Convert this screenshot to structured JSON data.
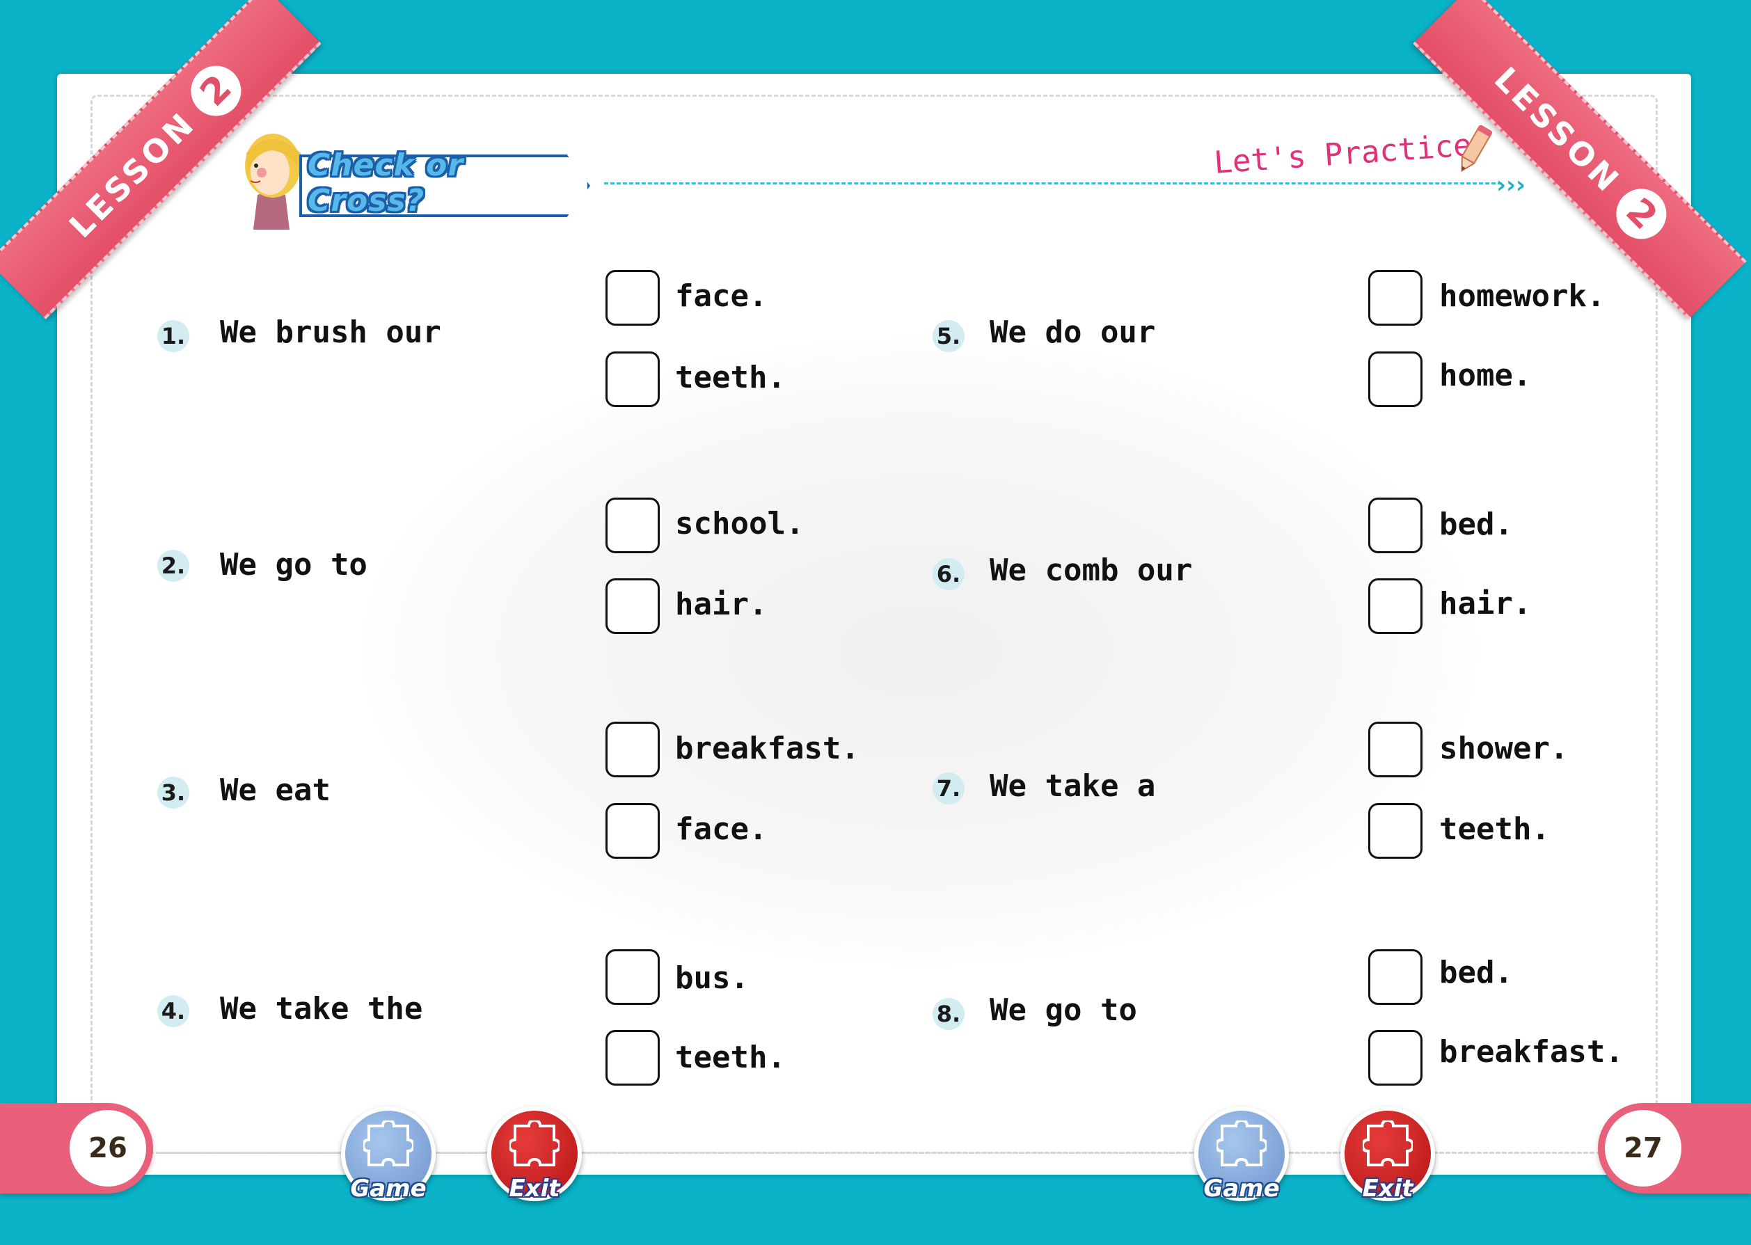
{
  "header": {
    "ribbon_label": "LESSON",
    "ribbon_number": "2",
    "activity_title": "Check or Cross?",
    "section_title": "Let's Practice",
    "arrows": "›››"
  },
  "questions": [
    {
      "number": "1.",
      "stem": "We brush our",
      "options": [
        "face.",
        "teeth."
      ]
    },
    {
      "number": "2.",
      "stem": "We go to",
      "options": [
        "school.",
        "hair."
      ]
    },
    {
      "number": "3.",
      "stem": "We eat",
      "options": [
        "breakfast.",
        "face."
      ]
    },
    {
      "number": "4.",
      "stem": "We take the",
      "options": [
        "bus.",
        "teeth."
      ]
    },
    {
      "number": "5.",
      "stem": "We do our",
      "options": [
        "homework.",
        "home."
      ]
    },
    {
      "number": "6.",
      "stem": "We comb our",
      "options": [
        "bed.",
        "hair."
      ]
    },
    {
      "number": "7.",
      "stem": "We take a",
      "options": [
        "shower.",
        "teeth."
      ]
    },
    {
      "number": "8.",
      "stem": "We go to",
      "options": [
        "bed.",
        "breakfast."
      ]
    }
  ],
  "footer": {
    "left_page": "26",
    "right_page": "27",
    "game_label": "Game",
    "exit_label": "Exit"
  },
  "icons": [
    "girl-character-icon",
    "pencil-icon",
    "puzzle-icon"
  ],
  "colors": {
    "background": "#0ab3c8",
    "ribbon": "#e34f67",
    "title_blue": "#1b5fa8",
    "practice_pink": "#e0307a"
  }
}
